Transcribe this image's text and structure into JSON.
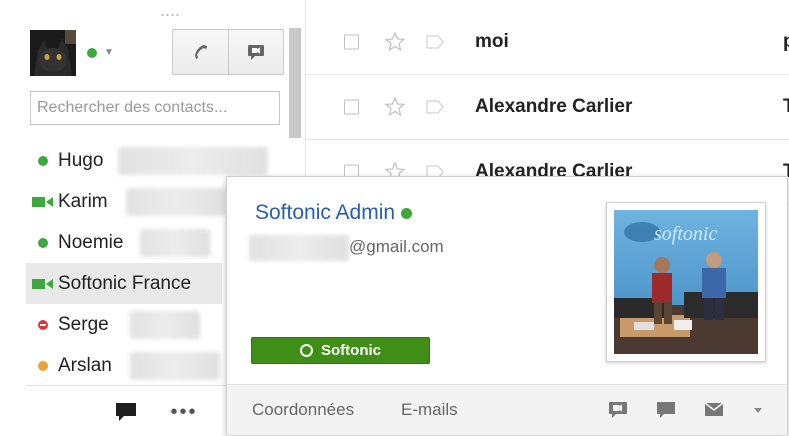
{
  "sidebar": {
    "search_placeholder": "Rechercher des contacts...",
    "contacts": [
      {
        "name": "Hugo",
        "status": "online"
      },
      {
        "name": "Karim",
        "status": "video"
      },
      {
        "name": "Noemie",
        "status": "online"
      },
      {
        "name": "Softonic France",
        "status": "video"
      },
      {
        "name": "Serge",
        "status": "busy"
      },
      {
        "name": "Arslan",
        "status": "idle"
      }
    ]
  },
  "messages": [
    {
      "sender": "moi",
      "snippet": "p"
    },
    {
      "sender": "Alexandre Carlier",
      "snippet": "T"
    },
    {
      "sender": "Alexandre Carlier",
      "snippet": "T"
    }
  ],
  "card": {
    "name": "Softonic Admin",
    "email_suffix": "@gmail.com",
    "circle_label": "Softonic",
    "photo_text": "softonic",
    "footer_links": {
      "details": "Coordonnées",
      "emails": "E-mails"
    }
  },
  "colors": {
    "online": "#3ea83e",
    "busy": "#d9363e",
    "idle": "#e8a33a",
    "accent": "#2a5db0",
    "circle": "#3f8e17"
  }
}
